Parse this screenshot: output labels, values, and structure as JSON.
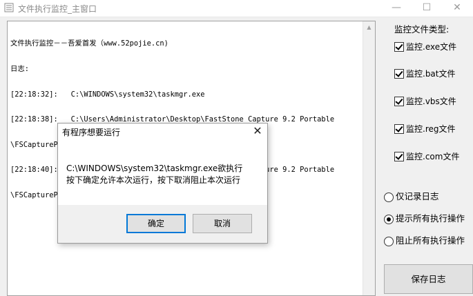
{
  "window": {
    "title": "文件执行监控_主窗口",
    "minimize_glyph": "—",
    "maximize_glyph": "☐",
    "close_glyph": "✕"
  },
  "log": {
    "lines": [
      "文件执行监控－－吾爱首发（www.52pojie.cn)",
      "日志:",
      "[22:18:32]:   C:\\WINDOWS\\system32\\taskmgr.exe",
      "[22:18:38]:   C:\\Users\\Administrator\\Desktop\\FastStone Capture 9.2 Portable",
      "\\FSCapturePortable.exe",
      "[22:18:40]:   C:\\Users\\Administrator\\Desktop\\FastStone Capture 9.2 Portable",
      "\\FSCapturePortable.exe    已运行"
    ]
  },
  "panel": {
    "types_title": "监控文件类型:",
    "checkboxes": [
      {
        "label": "监控.exe文件",
        "checked": true
      },
      {
        "label": "监控.bat文件",
        "checked": true
      },
      {
        "label": "监控.vbs文件",
        "checked": true
      },
      {
        "label": "监控.reg文件",
        "checked": true
      },
      {
        "label": "监控.com文件",
        "checked": true
      }
    ],
    "radios": [
      {
        "label": "仅记录日志",
        "selected": false
      },
      {
        "label": "提示所有执行操作",
        "selected": true
      },
      {
        "label": "阻止所有执行操作",
        "selected": false
      }
    ],
    "save_label": "保存日志"
  },
  "dialog": {
    "title": "有程序想要运行",
    "close_glyph": "✕",
    "message_line1": "C:\\WINDOWS\\system32\\taskmgr.exe欲执行",
    "message_line2": "按下确定允许本次运行，按下取消阻止本次运行",
    "ok_label": "确定",
    "cancel_label": "取消"
  },
  "colors": {
    "focus_border": "#0078d7",
    "title_text": "#8a8a8a"
  }
}
